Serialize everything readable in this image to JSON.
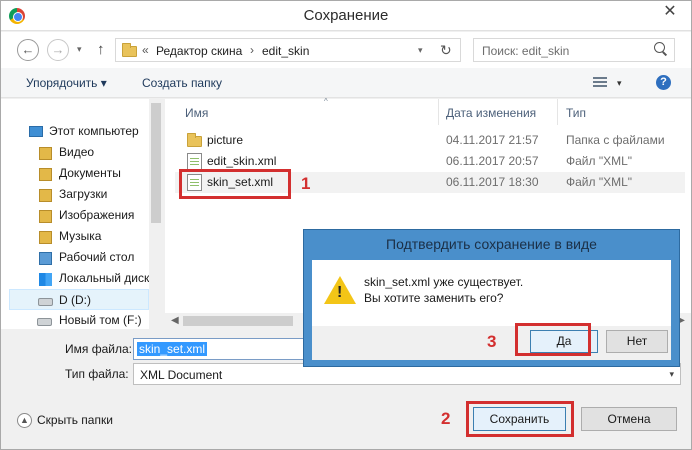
{
  "window": {
    "title": "Сохранение",
    "close_glyph": "✕"
  },
  "nav": {
    "back_glyph": "←",
    "forward_glyph": "→",
    "dropdown_glyph": "▾",
    "up_glyph": "↑",
    "refresh_glyph": "↻",
    "address": {
      "chevron": "«",
      "segments": [
        "Редактор скина",
        "edit_skin"
      ],
      "separator": "›"
    },
    "search_placeholder": "Поиск: edit_skin"
  },
  "commandbar": {
    "organize": "Упорядочить ▾",
    "new_folder": "Создать папку",
    "view_dropdown": "▾",
    "help": "?"
  },
  "sidebar": {
    "items": [
      {
        "label": "Этот компьютер",
        "icon": "computer-icon"
      },
      {
        "label": "Видео",
        "icon": "video-library-icon"
      },
      {
        "label": "Документы",
        "icon": "documents-library-icon"
      },
      {
        "label": "Загрузки",
        "icon": "downloads-folder-icon"
      },
      {
        "label": "Изображения",
        "icon": "pictures-library-icon"
      },
      {
        "label": "Музыка",
        "icon": "music-library-icon"
      },
      {
        "label": "Рабочий стол",
        "icon": "desktop-folder-icon"
      },
      {
        "label": "Локальный диск",
        "icon": "windows-drive-icon"
      },
      {
        "label": "D (D:)",
        "icon": "drive-icon",
        "selected": true
      },
      {
        "label": "Новый том (F:)",
        "icon": "drive-icon"
      }
    ]
  },
  "files": {
    "columns": [
      "Имя",
      "Дата изменения",
      "Тип"
    ],
    "sort_glyph": "^",
    "rows": [
      {
        "name": "picture",
        "date": "04.11.2017 21:57",
        "type": "Папка с файлами",
        "icon": "folder-icon"
      },
      {
        "name": "edit_skin.xml",
        "date": "06.11.2017 20:57",
        "type": "Файл \"XML\"",
        "icon": "xml-file-icon"
      },
      {
        "name": "skin_set.xml",
        "date": "06.11.2017 18:30",
        "type": "Файл \"XML\"",
        "icon": "xml-file-icon",
        "selected": true
      }
    ],
    "scroll_left": "◀",
    "scroll_right": "▶"
  },
  "form": {
    "filename_label": "Имя файла:",
    "filename_value": "skin_set.xml",
    "filetype_label": "Тип файла:",
    "filetype_value": "XML Document",
    "filetype_dropdown": "▾"
  },
  "footer": {
    "hide_folders": "Скрыть папки",
    "hide_glyph": "▲",
    "save": "Сохранить",
    "cancel": "Отмена"
  },
  "confirm_dialog": {
    "title": "Подтвердить сохранение в виде",
    "message_line1": "skin_set.xml уже существует.",
    "message_line2": "Вы хотите заменить его?",
    "yes": "Да",
    "no": "Нет"
  },
  "annotations": {
    "marker1": "1",
    "marker2": "2",
    "marker3": "3",
    "color": "#d32f2f"
  }
}
